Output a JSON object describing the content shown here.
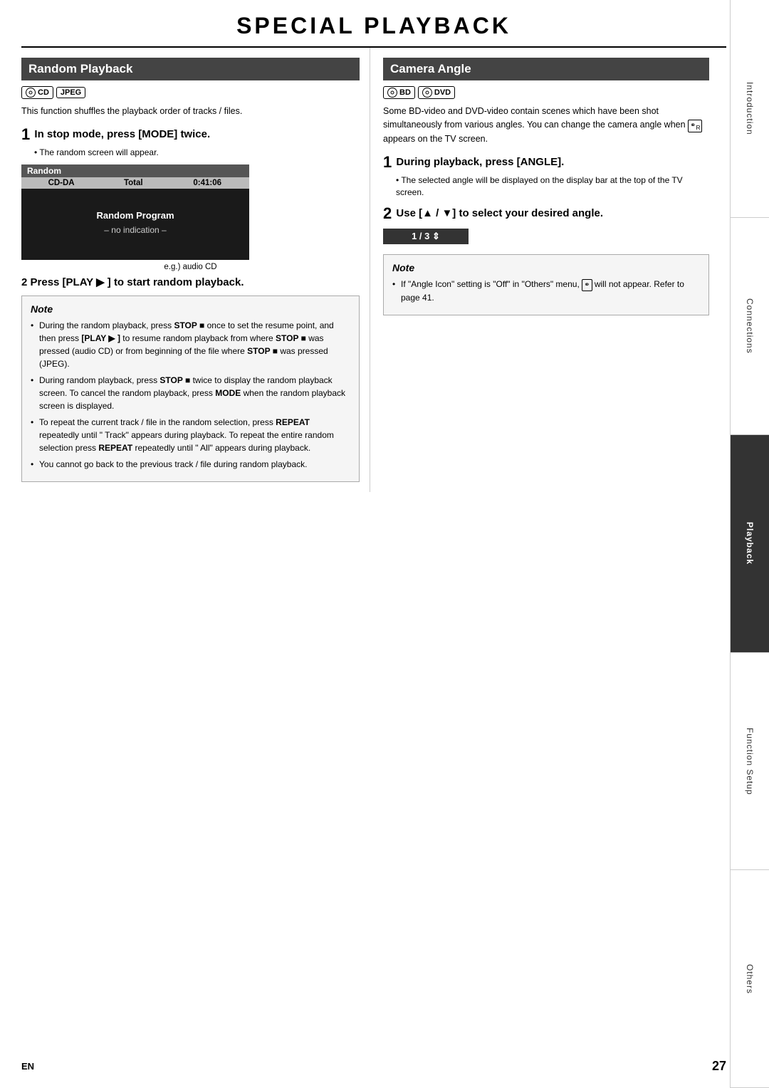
{
  "page": {
    "title": "SPECIAL PLAYBACK",
    "page_number": "27",
    "lang": "EN"
  },
  "sidebar": {
    "tabs": [
      {
        "id": "introduction",
        "label": "Introduction",
        "active": false
      },
      {
        "id": "connections",
        "label": "Connections",
        "active": false
      },
      {
        "id": "playback",
        "label": "Playback",
        "active": true
      },
      {
        "id": "function-setup",
        "label": "Function Setup",
        "active": false
      },
      {
        "id": "others",
        "label": "Others",
        "active": false
      }
    ]
  },
  "random_playback": {
    "section_title": "Random Playback",
    "badges": [
      "CD",
      "JPEG"
    ],
    "intro": "This function shuffles the playback order of tracks / files.",
    "step1_heading": "In stop mode, press [MODE] twice.",
    "step1_sub": "The random screen will appear.",
    "screen": {
      "header": "Random",
      "table_cols": [
        "CD-DA",
        "Total",
        "0:41:06"
      ],
      "body_label": "Random Program",
      "body_sub": "– no indication –"
    },
    "screen_caption": "e.g.) audio CD",
    "step2_heading": "Press [PLAY ▶ ] to start random playback.",
    "notes": [
      "During the random playback, press STOP ■  once to set the resume point, and then press [PLAY ▶ ] to resume random playback from where STOP ■  was pressed (audio CD) or from beginning of the file where STOP ■  was pressed (JPEG).",
      "During random playback, press STOP ■  twice to display the random playback screen. To cancel the random playback, press MODE when the random playback screen is displayed.",
      "To repeat the current track / file in the random selection, press REPEAT repeatedly until \" Track\" appears during playback. To repeat the entire random selection press REPEAT repeatedly until \" All\" appears during playback.",
      "You cannot go back to the previous track / file during random playback."
    ]
  },
  "camera_angle": {
    "section_title": "Camera Angle",
    "badges": [
      "BD",
      "DVD"
    ],
    "intro": "Some BD-video and DVD-video contain scenes which have been shot simultaneously from various angles. You can change the camera angle when  appears on the TV screen.",
    "step1_heading": "During playback, press [ANGLE].",
    "step1_sub": "The selected angle will be displayed on the display bar at the top of the TV screen.",
    "step2_heading": "Use [▲ / ▼] to select your desired angle.",
    "angle_bar": "1 / 3  ⇕",
    "note_title": "Note",
    "notes": [
      "If \"Angle Icon\" setting is \"Off\" in \"Others\" menu,  will not appear. Refer to page 41."
    ]
  }
}
